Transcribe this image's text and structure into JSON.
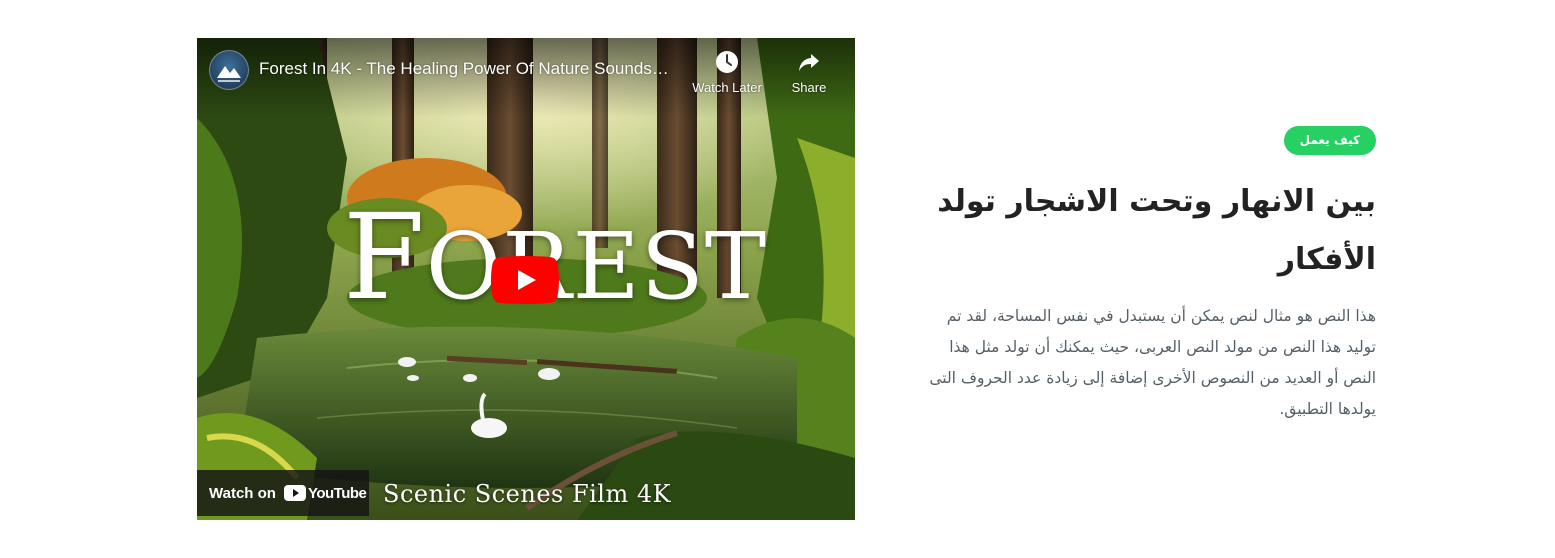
{
  "video": {
    "title": "Forest In 4K - The Healing Power Of Nature Sounds…",
    "watch_later_label": "Watch Later",
    "share_label": "Share",
    "overlay_title_first": "F",
    "overlay_title_rest": "OREST",
    "watch_on_label": "Watch on",
    "youtube_label": "YouTube",
    "caption": "Scenic Scenes Film 4K"
  },
  "section": {
    "badge": "كيف يعمل",
    "heading": "بين الانهار وتحت الاشجار تولد الأفكار",
    "paragraph": "هذا النص هو مثال لنص يمكن أن يستبدل في نفس المساحة، لقد تم توليد هذا النص من مولد النص العربى، حيث يمكنك أن تولد مثل هذا النص أو العديد من النصوص الأخرى إضافة إلى زيادة عدد الحروف التى يولدها التطبيق."
  },
  "colors": {
    "badge_green": "#26d063",
    "youtube_red": "#ff0000",
    "heading_text": "#222222",
    "body_text": "#555f66"
  },
  "icons": {
    "watch_later": "clock-icon",
    "share": "share-arrow-icon",
    "play": "youtube-play-icon",
    "channel": "channel-avatar-icon"
  }
}
